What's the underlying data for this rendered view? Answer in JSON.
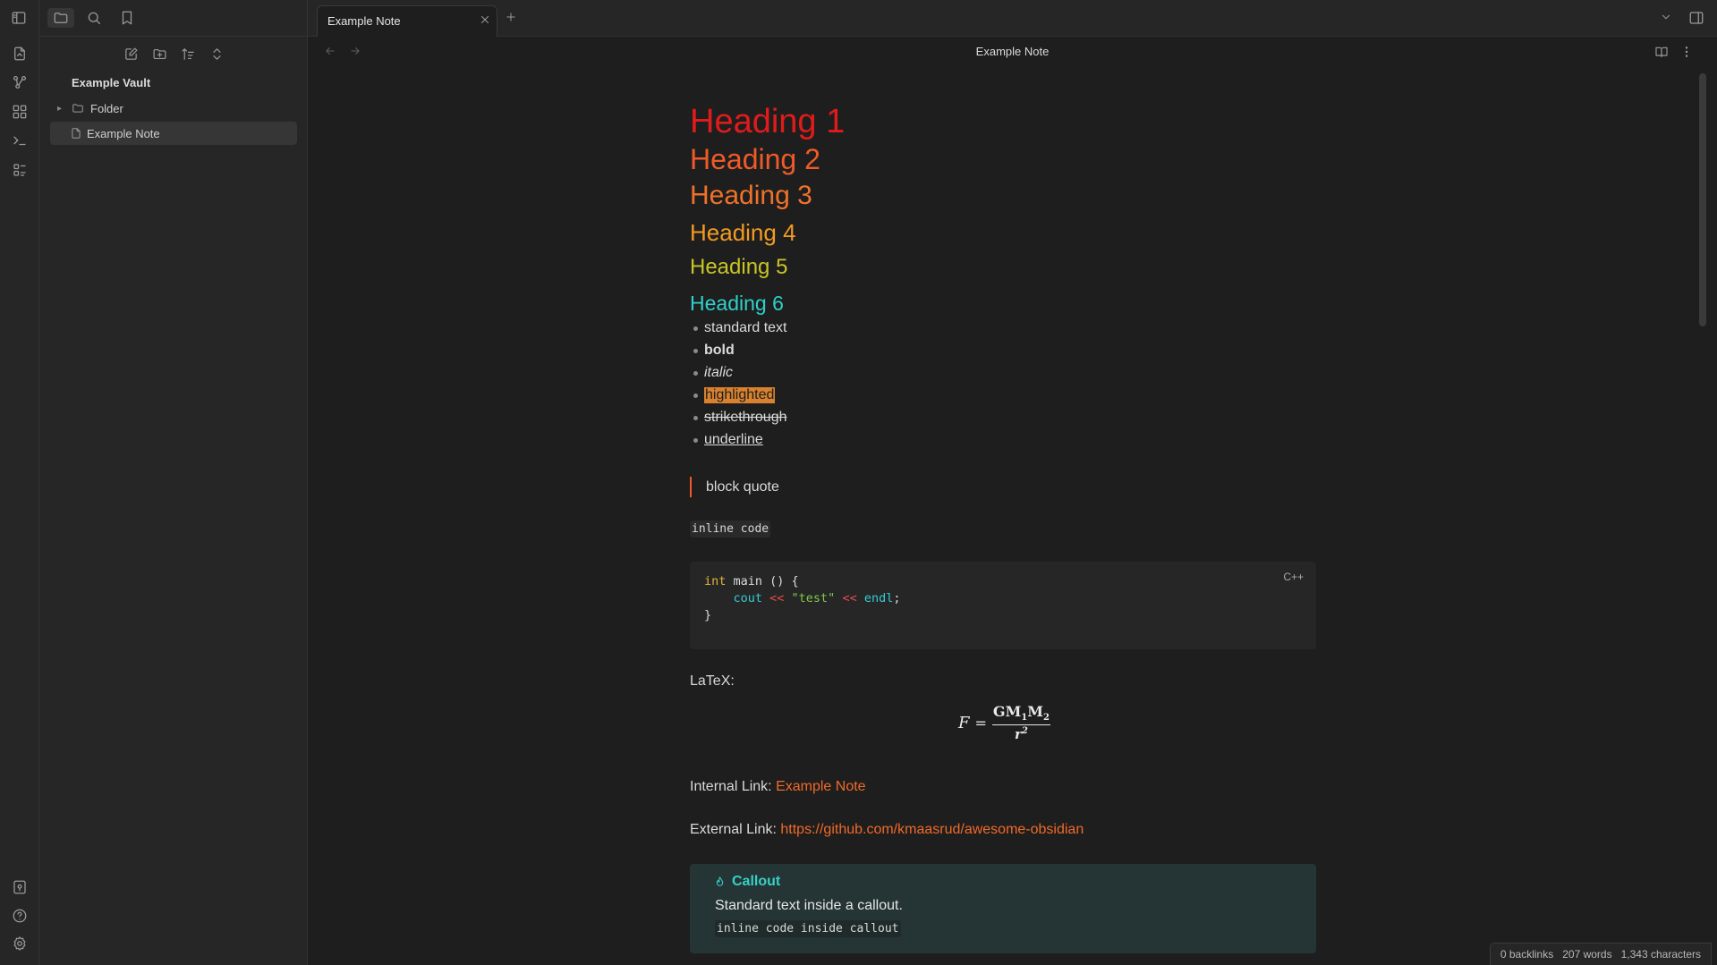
{
  "sidebar": {
    "vault_name": "Example Vault",
    "tree": [
      {
        "label": "Folder",
        "type": "folder"
      },
      {
        "label": "Example Note",
        "type": "file",
        "active": true
      }
    ]
  },
  "tabbar": {
    "tab_title": "Example Note"
  },
  "view": {
    "title": "Example Note"
  },
  "note": {
    "headings": [
      "Heading 1",
      "Heading 2",
      "Heading 3",
      "Heading 4",
      "Heading 5",
      "Heading 6"
    ],
    "bullets": {
      "standard": "standard text",
      "bold": "bold",
      "italic": "italic",
      "highlighted": "highlighted",
      "strikethrough": "strikethrough",
      "underline": "underline"
    },
    "block_quote": "block quote",
    "inline_code": "inline code",
    "code_block": {
      "language": "C++",
      "line1_kw": "int",
      "line1_rest": " main () {",
      "line2_indent": "    ",
      "line2_fn": "cout",
      "line2_op1": " << ",
      "line2_str": "\"test\"",
      "line2_op2": " << ",
      "line2_fn2": "endl",
      "line2_end": ";",
      "line3": "}"
    },
    "latex_label": "LaTeX:",
    "latex": {
      "lhs": "F",
      "eq": "=",
      "num": "GM",
      "sub1": "1",
      "num2": "M",
      "sub2": "2",
      "den": "r",
      "sup": "2"
    },
    "internal_link_label": "Internal Link: ",
    "internal_link": "Example Note",
    "external_link_label": "External Link: ",
    "external_link": "https://github.com/kmaasrud/awesome-obsidian",
    "callout": {
      "title": "Callout",
      "body": "Standard text inside a callout.",
      "code": "inline code inside callout"
    }
  },
  "status": {
    "backlinks": "0 backlinks",
    "words": "207 words",
    "characters": "1,343 characters"
  },
  "colors": {
    "h1": "#e01b1b",
    "h2": "#ef5a29",
    "h3": "#f0722a",
    "h4": "#f29b21",
    "h5": "#c9c526",
    "h6": "#2ed1c9",
    "link": "#ef6a2a",
    "callout_accent": "#37d0c5",
    "highlight": "#d8822f"
  }
}
